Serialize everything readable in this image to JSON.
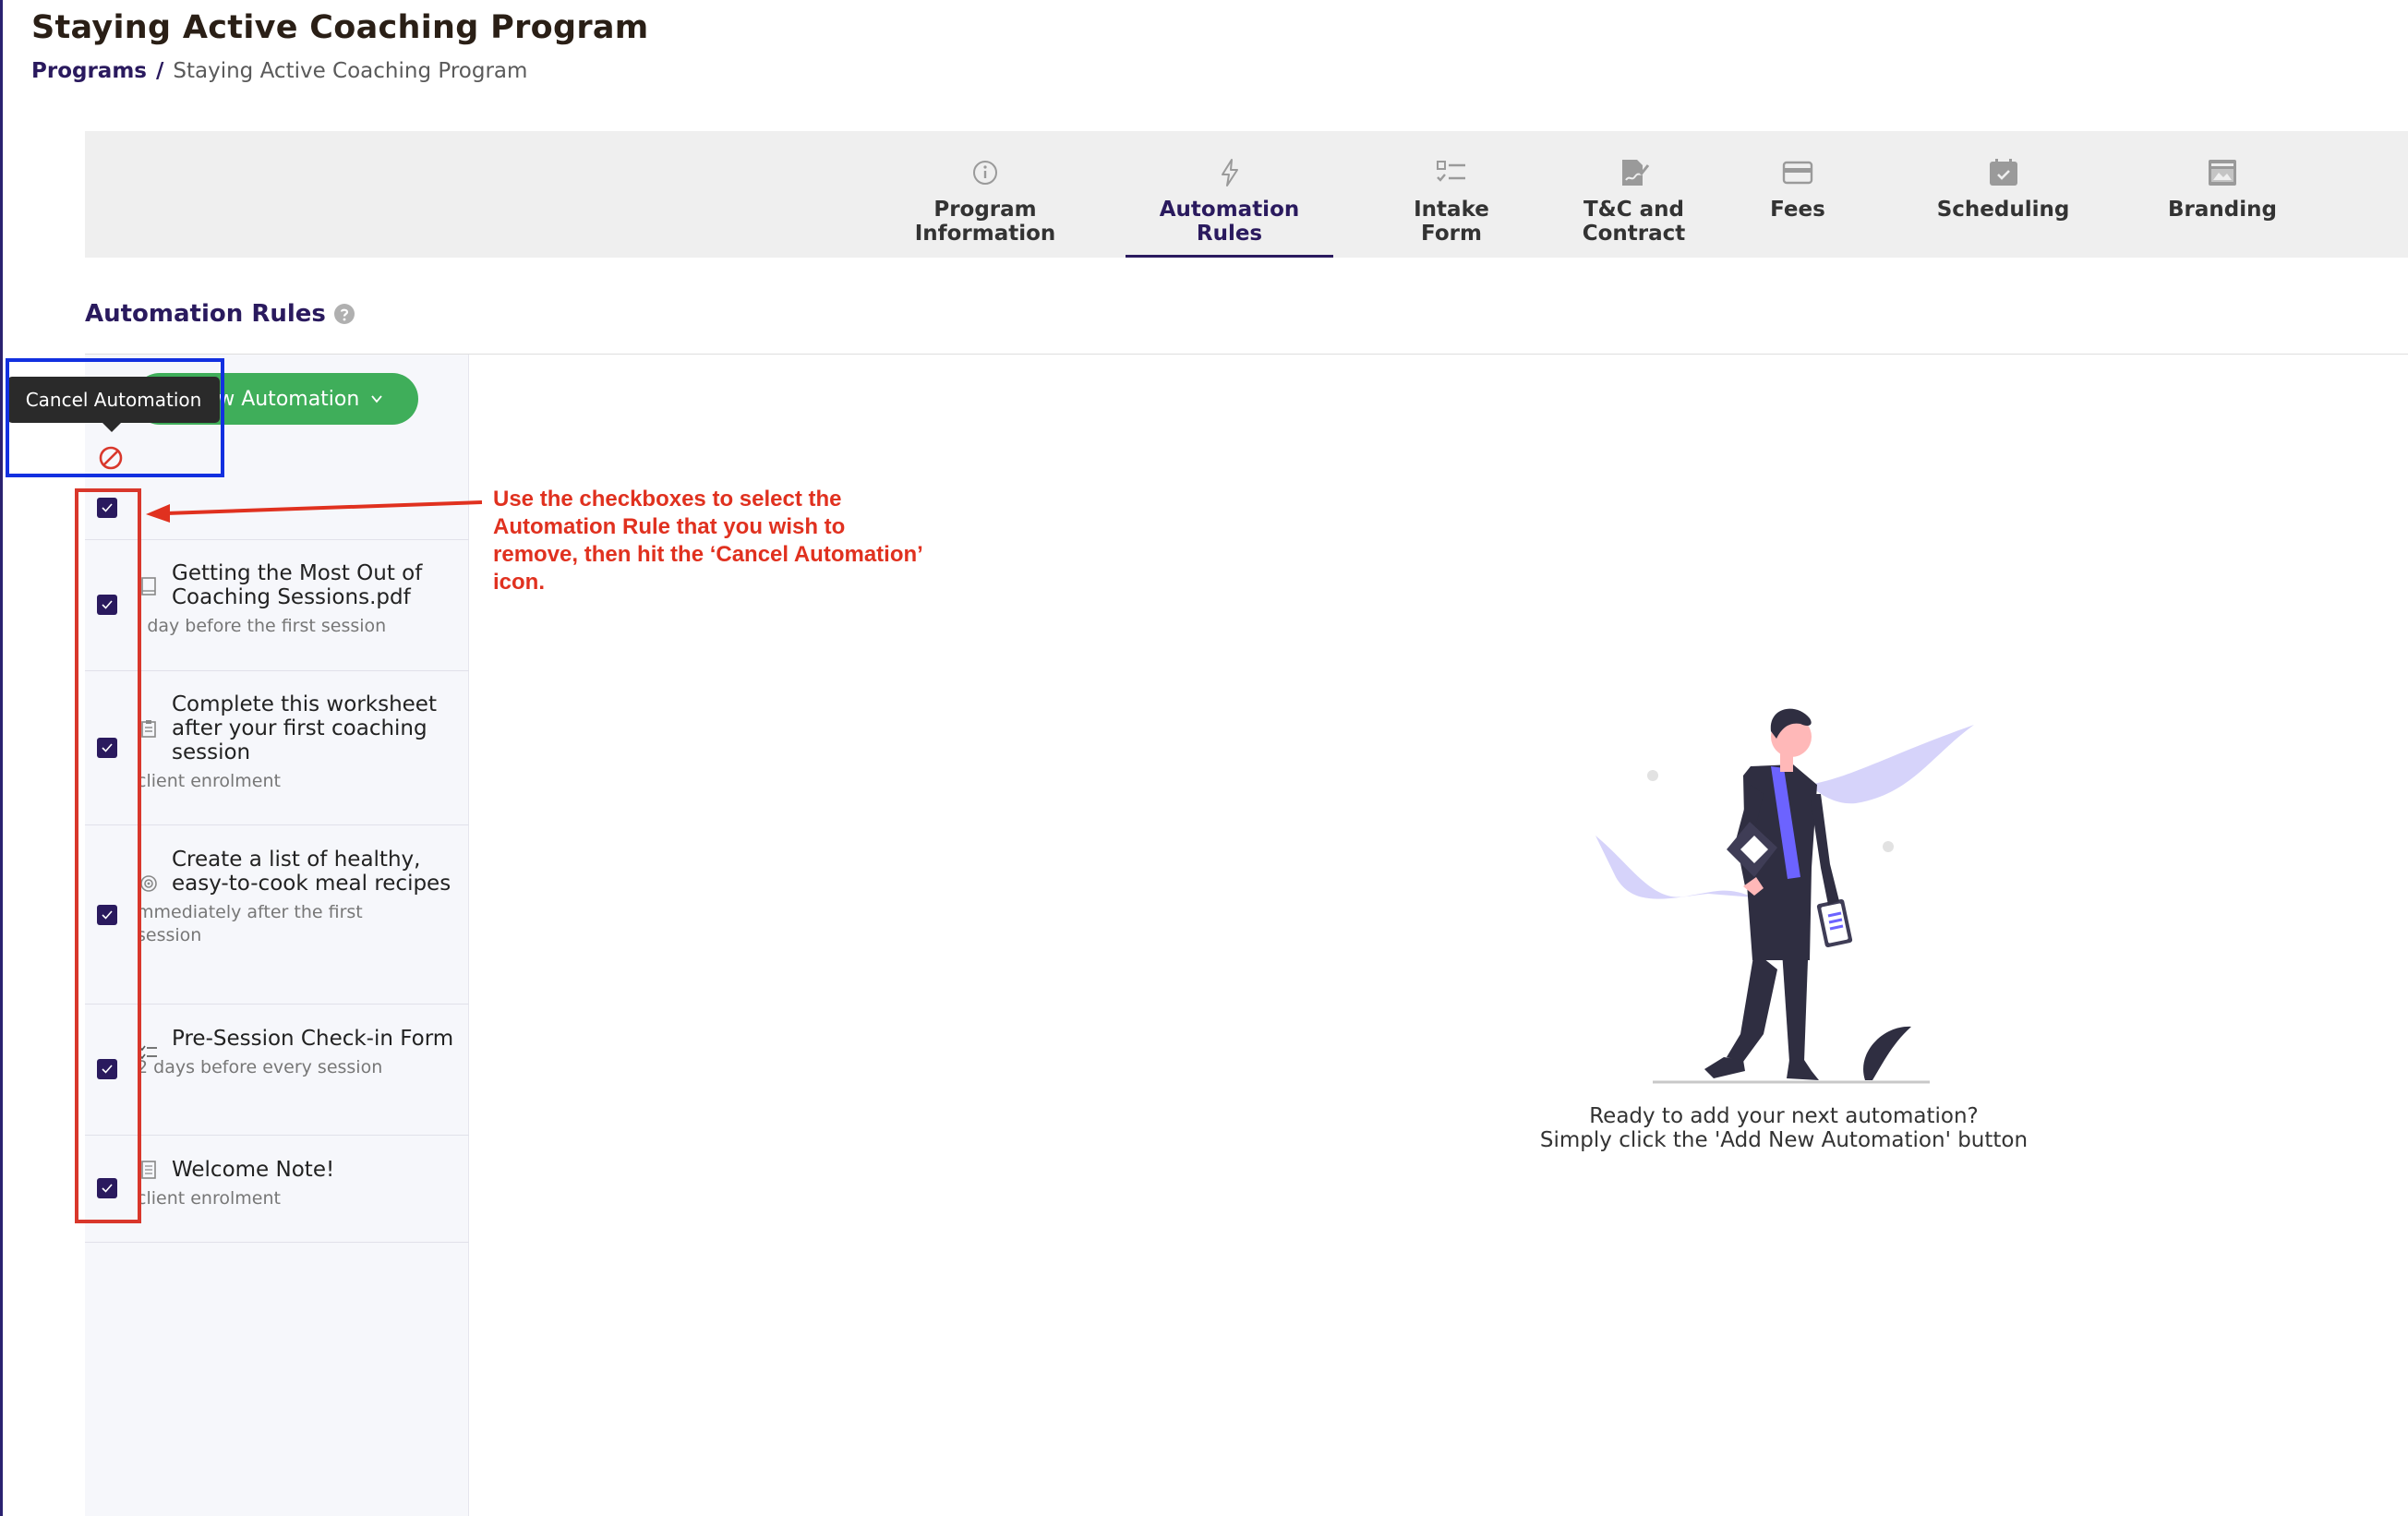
{
  "header": {
    "title": "Staying Active Coaching Program",
    "breadcrumb": {
      "link": "Programs",
      "separator": "/",
      "current": "Staying Active Coaching Program"
    }
  },
  "tabs": [
    {
      "label": "Program\nInformation",
      "icon": "info-circle-icon",
      "active": false
    },
    {
      "label": "Automation\nRules",
      "icon": "lightning-icon",
      "active": true
    },
    {
      "label": "Intake\nForm",
      "icon": "checklist-icon",
      "active": false
    },
    {
      "label": "T&C and\nContract",
      "icon": "signed-document-icon",
      "active": false
    },
    {
      "label": "Fees",
      "icon": "credit-card-icon",
      "active": false
    },
    {
      "label": "Scheduling",
      "icon": "calendar-check-icon",
      "active": false
    },
    {
      "label": "Branding",
      "icon": "branding-window-icon",
      "active": false
    }
  ],
  "section": {
    "title": "Automation Rules"
  },
  "toolbar": {
    "add_label": "ew Automation",
    "tooltip": "Cancel Automation"
  },
  "rules": [
    {
      "title": "Getting the Most Out of Coaching Sessions.pdf",
      "subtitle": "l day before the first session",
      "icon": "document-icon",
      "checked": true
    },
    {
      "title": "Complete this worksheet after your first coaching session",
      "subtitle": "client enrolment",
      "icon": "clipboard-icon",
      "checked": true
    },
    {
      "title": "Create a list of healthy, easy-to-cook meal recipes",
      "subtitle": "mmediately after the first session",
      "icon": "target-icon",
      "checked": true
    },
    {
      "title": "Pre-Session Check-in Form",
      "subtitle": "2 days before every session",
      "icon": "checklist-icon",
      "checked": true
    },
    {
      "title": "Welcome Note!",
      "subtitle": "client enrolment",
      "icon": "note-icon",
      "checked": true
    }
  ],
  "annotation": {
    "text": "Use the checkboxes to select the Automation Rule that you wish to remove, then hit the ‘Cancel Automation’ icon."
  },
  "empty_state": {
    "line1": "Ready to add your next automation?",
    "line2": "Simply click the 'Add New Automation' button"
  },
  "colors": {
    "primary": "#2a1a5e",
    "add_button": "#3fae5a",
    "annotation_red": "#e0311f",
    "highlight_blue": "#1230e0",
    "tab_bar_bg": "#efefef",
    "illustration_accent": "#6c63ff"
  }
}
